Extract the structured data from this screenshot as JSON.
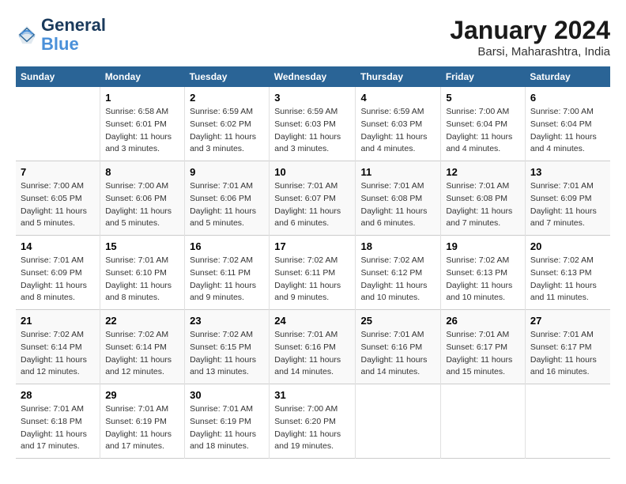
{
  "header": {
    "logo_line1": "General",
    "logo_line2": "Blue",
    "month_title": "January 2024",
    "subtitle": "Barsi, Maharashtra, India"
  },
  "columns": [
    "Sunday",
    "Monday",
    "Tuesday",
    "Wednesday",
    "Thursday",
    "Friday",
    "Saturday"
  ],
  "weeks": [
    {
      "days": [
        {
          "num": "",
          "info": ""
        },
        {
          "num": "1",
          "info": "Sunrise: 6:58 AM\nSunset: 6:01 PM\nDaylight: 11 hours\nand 3 minutes."
        },
        {
          "num": "2",
          "info": "Sunrise: 6:59 AM\nSunset: 6:02 PM\nDaylight: 11 hours\nand 3 minutes."
        },
        {
          "num": "3",
          "info": "Sunrise: 6:59 AM\nSunset: 6:03 PM\nDaylight: 11 hours\nand 3 minutes."
        },
        {
          "num": "4",
          "info": "Sunrise: 6:59 AM\nSunset: 6:03 PM\nDaylight: 11 hours\nand 4 minutes."
        },
        {
          "num": "5",
          "info": "Sunrise: 7:00 AM\nSunset: 6:04 PM\nDaylight: 11 hours\nand 4 minutes."
        },
        {
          "num": "6",
          "info": "Sunrise: 7:00 AM\nSunset: 6:04 PM\nDaylight: 11 hours\nand 4 minutes."
        }
      ]
    },
    {
      "days": [
        {
          "num": "7",
          "info": "Sunrise: 7:00 AM\nSunset: 6:05 PM\nDaylight: 11 hours\nand 5 minutes."
        },
        {
          "num": "8",
          "info": "Sunrise: 7:00 AM\nSunset: 6:06 PM\nDaylight: 11 hours\nand 5 minutes."
        },
        {
          "num": "9",
          "info": "Sunrise: 7:01 AM\nSunset: 6:06 PM\nDaylight: 11 hours\nand 5 minutes."
        },
        {
          "num": "10",
          "info": "Sunrise: 7:01 AM\nSunset: 6:07 PM\nDaylight: 11 hours\nand 6 minutes."
        },
        {
          "num": "11",
          "info": "Sunrise: 7:01 AM\nSunset: 6:08 PM\nDaylight: 11 hours\nand 6 minutes."
        },
        {
          "num": "12",
          "info": "Sunrise: 7:01 AM\nSunset: 6:08 PM\nDaylight: 11 hours\nand 7 minutes."
        },
        {
          "num": "13",
          "info": "Sunrise: 7:01 AM\nSunset: 6:09 PM\nDaylight: 11 hours\nand 7 minutes."
        }
      ]
    },
    {
      "days": [
        {
          "num": "14",
          "info": "Sunrise: 7:01 AM\nSunset: 6:09 PM\nDaylight: 11 hours\nand 8 minutes."
        },
        {
          "num": "15",
          "info": "Sunrise: 7:01 AM\nSunset: 6:10 PM\nDaylight: 11 hours\nand 8 minutes."
        },
        {
          "num": "16",
          "info": "Sunrise: 7:02 AM\nSunset: 6:11 PM\nDaylight: 11 hours\nand 9 minutes."
        },
        {
          "num": "17",
          "info": "Sunrise: 7:02 AM\nSunset: 6:11 PM\nDaylight: 11 hours\nand 9 minutes."
        },
        {
          "num": "18",
          "info": "Sunrise: 7:02 AM\nSunset: 6:12 PM\nDaylight: 11 hours\nand 10 minutes."
        },
        {
          "num": "19",
          "info": "Sunrise: 7:02 AM\nSunset: 6:13 PM\nDaylight: 11 hours\nand 10 minutes."
        },
        {
          "num": "20",
          "info": "Sunrise: 7:02 AM\nSunset: 6:13 PM\nDaylight: 11 hours\nand 11 minutes."
        }
      ]
    },
    {
      "days": [
        {
          "num": "21",
          "info": "Sunrise: 7:02 AM\nSunset: 6:14 PM\nDaylight: 11 hours\nand 12 minutes."
        },
        {
          "num": "22",
          "info": "Sunrise: 7:02 AM\nSunset: 6:14 PM\nDaylight: 11 hours\nand 12 minutes."
        },
        {
          "num": "23",
          "info": "Sunrise: 7:02 AM\nSunset: 6:15 PM\nDaylight: 11 hours\nand 13 minutes."
        },
        {
          "num": "24",
          "info": "Sunrise: 7:01 AM\nSunset: 6:16 PM\nDaylight: 11 hours\nand 14 minutes."
        },
        {
          "num": "25",
          "info": "Sunrise: 7:01 AM\nSunset: 6:16 PM\nDaylight: 11 hours\nand 14 minutes."
        },
        {
          "num": "26",
          "info": "Sunrise: 7:01 AM\nSunset: 6:17 PM\nDaylight: 11 hours\nand 15 minutes."
        },
        {
          "num": "27",
          "info": "Sunrise: 7:01 AM\nSunset: 6:17 PM\nDaylight: 11 hours\nand 16 minutes."
        }
      ]
    },
    {
      "days": [
        {
          "num": "28",
          "info": "Sunrise: 7:01 AM\nSunset: 6:18 PM\nDaylight: 11 hours\nand 17 minutes."
        },
        {
          "num": "29",
          "info": "Sunrise: 7:01 AM\nSunset: 6:19 PM\nDaylight: 11 hours\nand 17 minutes."
        },
        {
          "num": "30",
          "info": "Sunrise: 7:01 AM\nSunset: 6:19 PM\nDaylight: 11 hours\nand 18 minutes."
        },
        {
          "num": "31",
          "info": "Sunrise: 7:00 AM\nSunset: 6:20 PM\nDaylight: 11 hours\nand 19 minutes."
        },
        {
          "num": "",
          "info": ""
        },
        {
          "num": "",
          "info": ""
        },
        {
          "num": "",
          "info": ""
        }
      ]
    }
  ]
}
